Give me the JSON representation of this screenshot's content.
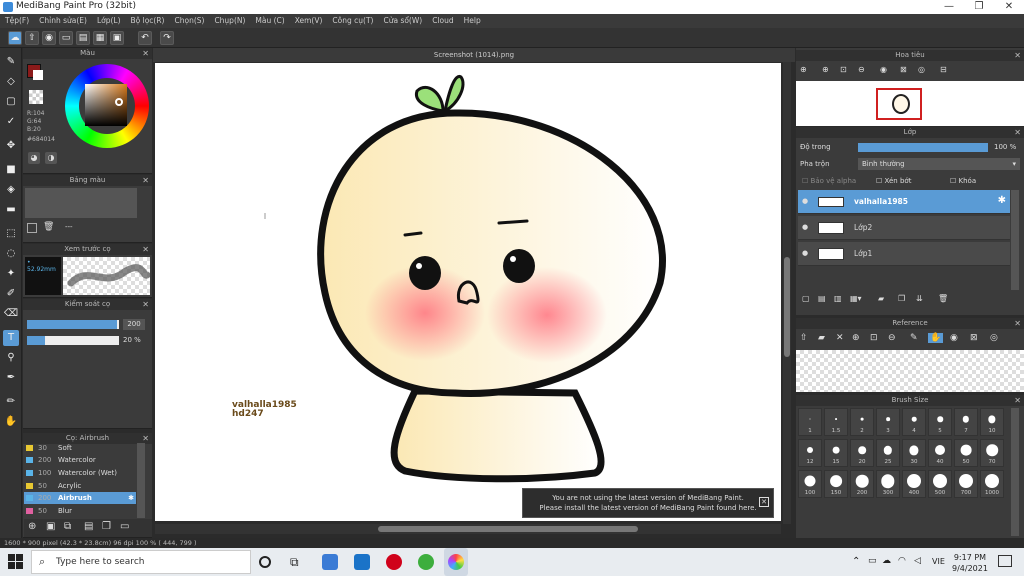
{
  "window": {
    "title": "MediBang Paint Pro (32bit)",
    "controls": [
      "—",
      "❐",
      "✕"
    ]
  },
  "menu": [
    "Tệp(F)",
    "Chỉnh sửa(E)",
    "Lớp(L)",
    "Bộ lọc(R)",
    "Chọn(S)",
    "Chụp(N)",
    "Màu (C)",
    "Xem(V)",
    "Công cụ(T)",
    "Cửa sổ(W)",
    "Cloud",
    "Help"
  ],
  "document": {
    "tab_title": "Screenshot (1014).png",
    "watermark_line1": "valhalla1985",
    "watermark_line2": "hd247"
  },
  "color_panel": {
    "title": "Màu",
    "r": "R:104",
    "g": "G:64",
    "b": "B:20",
    "hex": "#684014",
    "primary_color": "#8b1a1a"
  },
  "palette_panel": {
    "title": "Bảng màu",
    "dash": "---"
  },
  "preview_panel": {
    "title": "Xem trước cọ",
    "size": "52.92mm"
  },
  "brush_control": {
    "title": "Kiểm soát cọ",
    "size_value": "200",
    "opacity_value": "20 %",
    "size_fraction": 0.98,
    "opacity_fraction": 0.2
  },
  "brush_list": {
    "title": "Cọ: Airbrush",
    "items": [
      {
        "num": "30",
        "name": "Soft",
        "color": "#e8c832"
      },
      {
        "num": "200",
        "name": "Watercolor",
        "color": "#5ab4e8"
      },
      {
        "num": "100",
        "name": "Watercolor (Wet)",
        "color": "#5ab4e8"
      },
      {
        "num": "50",
        "name": "Acrylic",
        "color": "#e8c832"
      },
      {
        "num": "200",
        "name": "Airbrush",
        "color": "#5ab4e8",
        "selected": true
      },
      {
        "num": "50",
        "name": "Blur",
        "color": "#e060a0"
      }
    ]
  },
  "navigator": {
    "title": "Hoa tiêu"
  },
  "layers_panel": {
    "title": "Lớp",
    "opacity_label": "Độ trong",
    "opacity_value": "100 %",
    "blend_label": "Pha trộn",
    "blend_value": "Bình thường",
    "protect_alpha": "Bảo vệ alpha",
    "clipping": "Xén bớt",
    "lock": "Khóa",
    "layers": [
      {
        "name": "valhalla1985",
        "selected": true
      },
      {
        "name": "Lớp2",
        "selected": false
      },
      {
        "name": "Lớp1",
        "selected": false
      }
    ]
  },
  "reference_panel": {
    "title": "Reference"
  },
  "brush_size_panel": {
    "title": "Brush Size",
    "sizes": [
      "1",
      "1.5",
      "2",
      "3",
      "4",
      "5",
      "7",
      "10",
      "12",
      "15",
      "20",
      "25",
      "30",
      "40",
      "50",
      "70",
      "100",
      "150",
      "200",
      "300",
      "400",
      "500",
      "700",
      "1000"
    ]
  },
  "notification": {
    "line1": "You are not using the latest version of MediBang Paint.",
    "line2": "Please install the latest version of MediBang Paint found here."
  },
  "status_bar": "1600 * 900 pixel  (42.3 * 23.8cm)  96 dpi  100 %  ( 444, 799 )",
  "taskbar": {
    "search_placeholder": "Type here to search",
    "lang": "VIE",
    "time": "9:17 PM",
    "date": "9/4/2021"
  }
}
